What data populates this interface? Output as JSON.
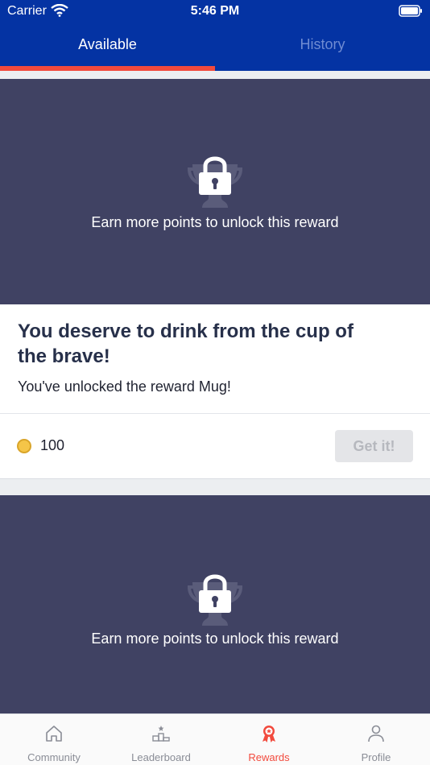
{
  "status_bar": {
    "carrier": "Carrier",
    "time": "5:46 PM"
  },
  "tabs": [
    {
      "label": "Available",
      "active": true
    },
    {
      "label": "History",
      "active": false
    }
  ],
  "rewards": [
    {
      "locked_message": "Earn more points to unlock this reward",
      "title": "You deserve to drink from the cup of the brave!",
      "description": "You've unlocked the reward Mug!",
      "points": "100",
      "button_label": "Get it!"
    },
    {
      "locked_message": "Earn more points to unlock this reward"
    }
  ],
  "bottom_nav": [
    {
      "label": "Community",
      "icon": "home-icon",
      "active": false
    },
    {
      "label": "Leaderboard",
      "icon": "podium-icon",
      "active": false
    },
    {
      "label": "Rewards",
      "icon": "ribbon-icon",
      "active": true
    },
    {
      "label": "Profile",
      "icon": "person-icon",
      "active": false
    }
  ],
  "colors": {
    "header": "#0433a3",
    "accent": "#f24a3d",
    "card_hero": "#404263",
    "coin": "#f5c548"
  }
}
